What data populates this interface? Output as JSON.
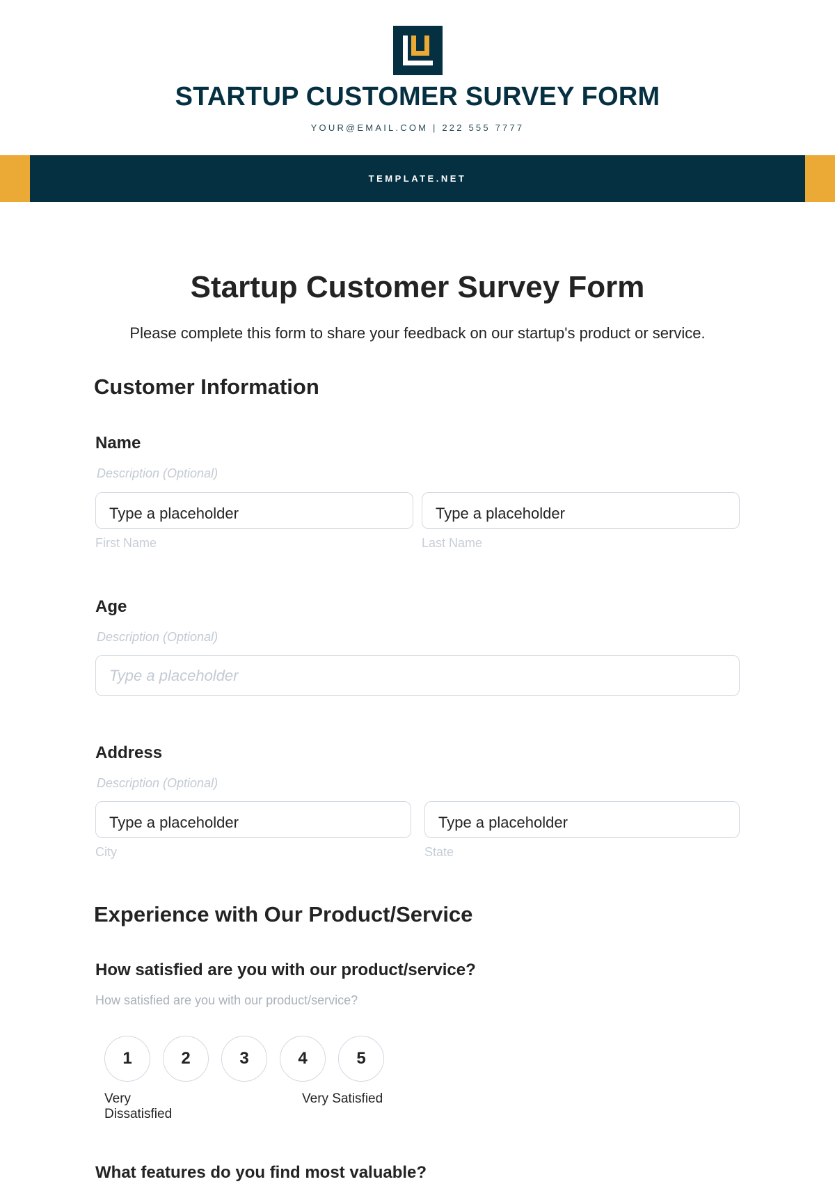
{
  "header": {
    "logo_icon": "brand-logo-icon",
    "brand_title": "STARTUP CUSTOMER SURVEY FORM",
    "contact": "YOUR@EMAIL.COM | 222 555 7777",
    "band_text": "TEMPLATE.NET",
    "colors": {
      "primary": "#053041",
      "accent": "#EBAA35"
    }
  },
  "form": {
    "title": "Startup Customer Survey Form",
    "description": "Please complete this form to share your feedback on our startup's product or service."
  },
  "sections": {
    "customer_info": {
      "title": "Customer Information",
      "name": {
        "label": "Name",
        "description": "Description (Optional)",
        "first": {
          "value": "Type a placeholder",
          "sub_label": "First Name"
        },
        "last": {
          "value": "Type a placeholder",
          "sub_label": "Last Name"
        }
      },
      "age": {
        "label": "Age",
        "description": "Description (Optional)",
        "placeholder": "Type a placeholder"
      },
      "address": {
        "label": "Address",
        "description": "Description (Optional)",
        "city": {
          "value": "Type a placeholder",
          "sub_label": "City"
        },
        "state": {
          "value": "Type a placeholder",
          "sub_label": "State"
        }
      }
    },
    "experience": {
      "title": "Experience with Our Product/Service",
      "satisfaction": {
        "question": "How satisfied are you with our product/service?",
        "help": "How satisfied are you with our product/service?",
        "options": [
          "1",
          "2",
          "3",
          "4",
          "5"
        ],
        "low_label": "Very Dissatisfied",
        "high_label": "Very Satisfied"
      },
      "features": {
        "question": "What features do you find most valuable?"
      }
    }
  }
}
